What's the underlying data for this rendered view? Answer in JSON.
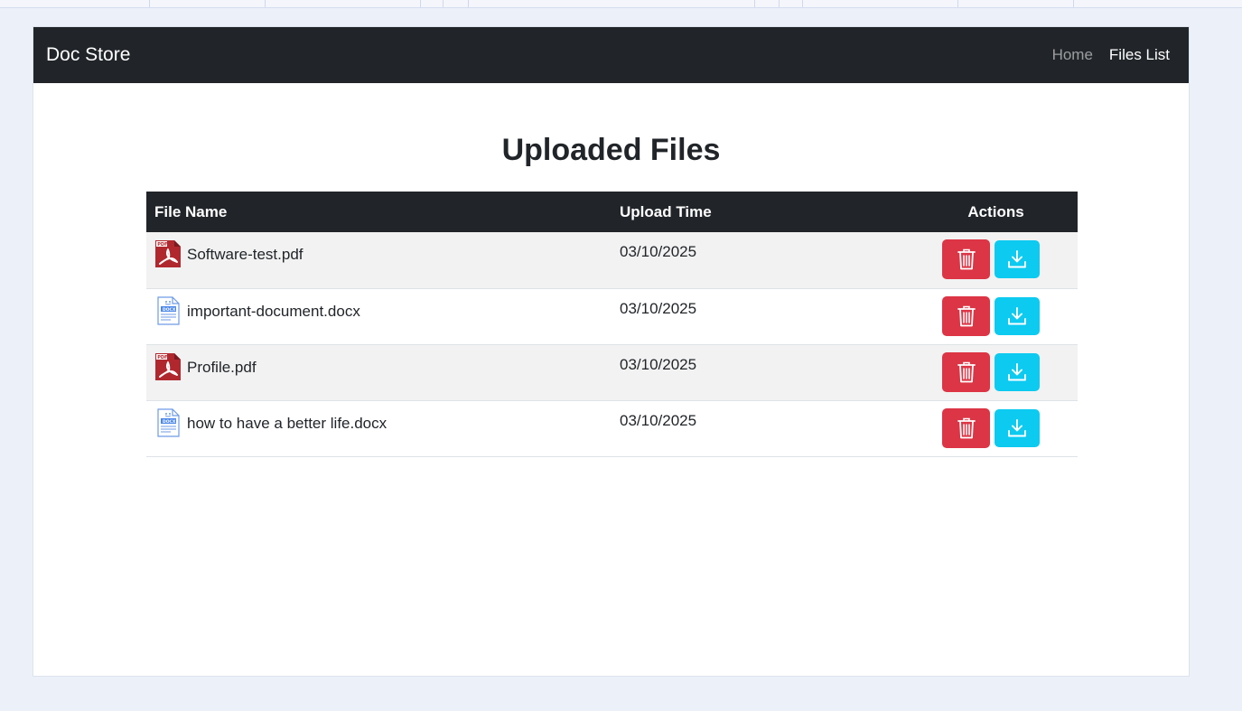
{
  "navbar": {
    "brand": "Doc Store",
    "links": [
      {
        "label": "Home",
        "active": false
      },
      {
        "label": "Files List",
        "active": true
      }
    ]
  },
  "page": {
    "title": "Uploaded Files"
  },
  "table": {
    "headers": {
      "name": "File Name",
      "time": "Upload Time",
      "actions": "Actions"
    },
    "rows": [
      {
        "icon": "pdf-icon",
        "name": "Software-test.pdf",
        "time": "03/10/2025"
      },
      {
        "icon": "docx-icon",
        "name": "important-document.docx",
        "time": "03/10/2025"
      },
      {
        "icon": "pdf-icon",
        "name": "Profile.pdf",
        "time": "03/10/2025"
      },
      {
        "icon": "docx-icon",
        "name": "how to have a better life.docx",
        "time": "03/10/2025"
      }
    ]
  },
  "colors": {
    "navbar": "#212529",
    "delete": "#dc3545",
    "download": "#0dcaf0",
    "pdf": "#b0282e",
    "docx": "#4a86e8"
  }
}
